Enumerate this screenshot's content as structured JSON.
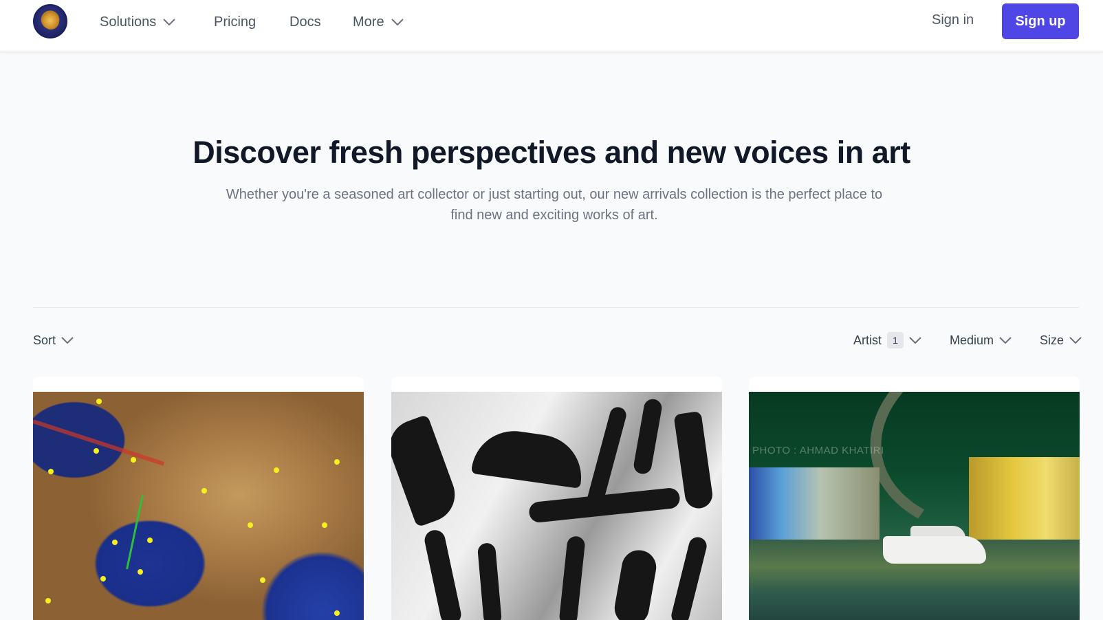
{
  "nav": {
    "logo_name": "lion-emblem-logo",
    "items": [
      {
        "label": "Solutions",
        "has_dropdown": true
      },
      {
        "label": "Pricing",
        "has_dropdown": false
      },
      {
        "label": "Docs",
        "has_dropdown": false
      },
      {
        "label": "More",
        "has_dropdown": true
      }
    ],
    "sign_in": "Sign in",
    "sign_up": "Sign up"
  },
  "hero": {
    "title": "Discover fresh perspectives and new voices in art",
    "subtitle": "Whether you're a seasoned art collector or just starting out, our new arrivals collection is the perfect place to find new and exciting works of art."
  },
  "filters": {
    "sort": "Sort",
    "artist": {
      "label": "Artist",
      "count": "1"
    },
    "medium": "Medium",
    "size": "Size"
  },
  "cards": [
    {
      "image_name": "flight-map-image"
    },
    {
      "image_name": "arabic-calligraphy-image"
    },
    {
      "image_name": "marina-yacht-image",
      "watermark": "PHOTO : AHMAD KHATIRI"
    }
  ],
  "colors": {
    "accent": "#4f46e5",
    "page_bg": "#f9fafb",
    "title": "#111827",
    "muted": "#6b7280"
  }
}
